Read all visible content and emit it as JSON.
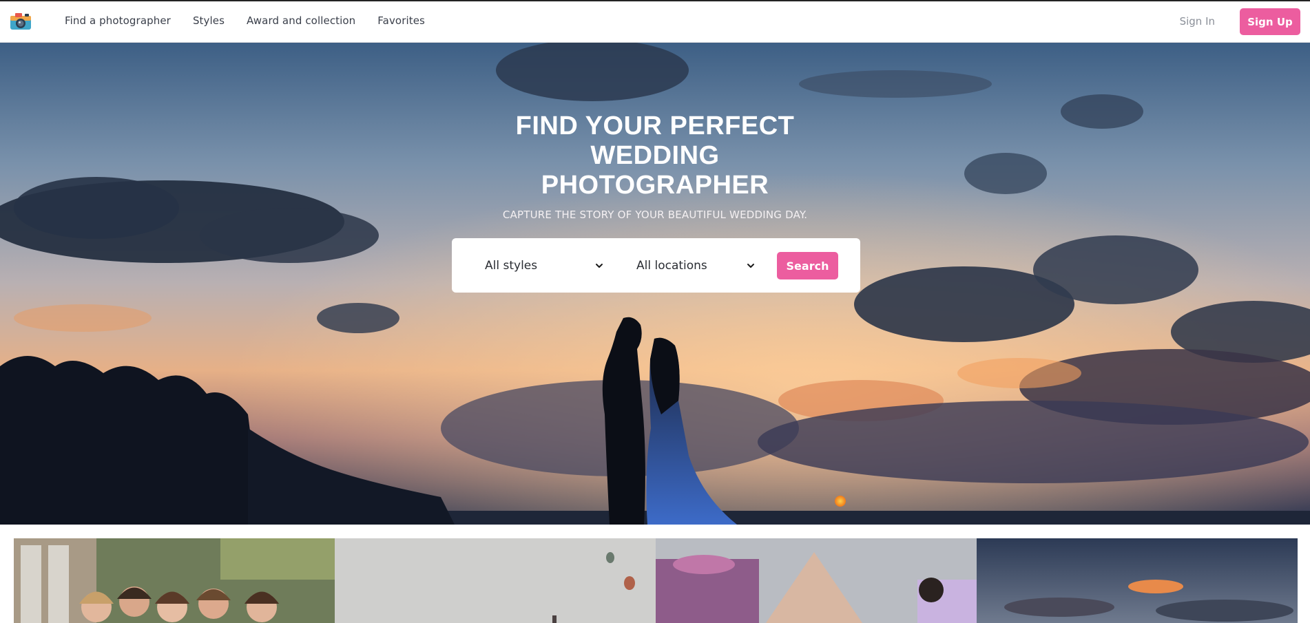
{
  "nav": {
    "logo_icon": "camera-icon",
    "links": [
      "Find a photographer",
      "Styles",
      "Award and collection",
      "Favorites"
    ],
    "sign_in": "Sign In",
    "sign_up": "Sign Up"
  },
  "hero": {
    "title_lines": [
      "FIND YOUR PERFECT",
      "WEDDING",
      "PHOTOGRAPHER"
    ],
    "subtitle": "CAPTURE THE STORY OF YOUR BEAUTIFUL WEDDING DAY.",
    "search": {
      "styles_value": "All styles",
      "locations_value": "All locations",
      "button": "Search",
      "chevron_icon": "chevron-down-icon"
    }
  },
  "colors": {
    "accent": "#ec5d9f",
    "nav_text": "#3a3f4a",
    "muted": "#8a8f98"
  }
}
